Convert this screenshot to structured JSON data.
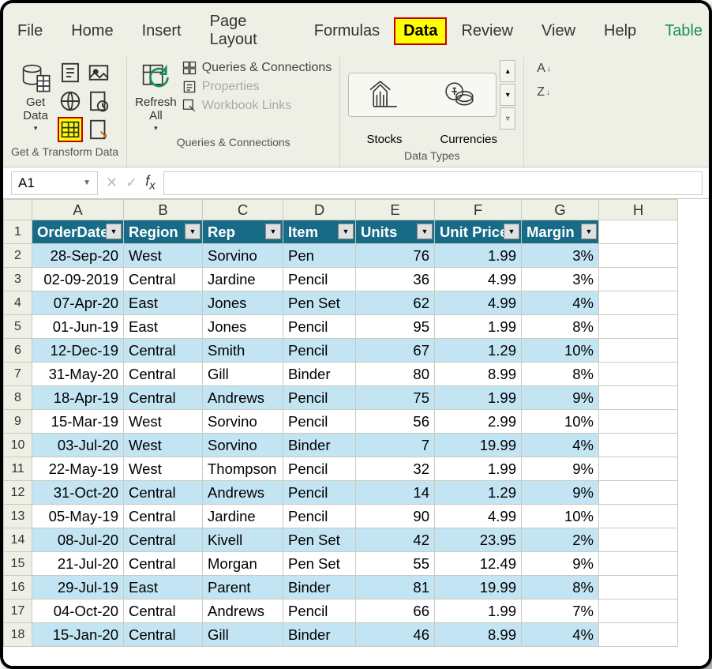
{
  "menu": {
    "items": [
      "File",
      "Home",
      "Insert",
      "Page Layout",
      "Formulas",
      "Data",
      "Review",
      "View",
      "Help",
      "Table"
    ],
    "active": "Data"
  },
  "ribbon": {
    "get_label": "Get\nData",
    "refresh_label": "Refresh\nAll",
    "queries": "Queries & Connections",
    "properties": "Properties",
    "workbook": "Workbook Links",
    "stocks": "Stocks",
    "currencies": "Currencies",
    "group1": "Get & Transform Data",
    "group2": "Queries & Connections",
    "group3": "Data Types"
  },
  "namebox": "A1",
  "formula": "",
  "columns": [
    "A",
    "B",
    "C",
    "D",
    "E",
    "F",
    "G",
    "H"
  ],
  "col_widths": [
    "colA",
    "colB",
    "colC",
    "colD",
    "colE",
    "colF",
    "colG",
    "colH"
  ],
  "headers": [
    "OrderDate",
    "Region",
    "Rep",
    "Item",
    "Units",
    "Unit Price",
    "Margin"
  ],
  "rows": [
    {
      "n": 2,
      "d": [
        "28-Sep-20",
        "West",
        "Sorvino",
        "Pen",
        "76",
        "1.99",
        "3%"
      ]
    },
    {
      "n": 3,
      "d": [
        "02-09-2019",
        "Central",
        "Jardine",
        "Pencil",
        "36",
        "4.99",
        "3%"
      ]
    },
    {
      "n": 4,
      "d": [
        "07-Apr-20",
        "East",
        "Jones",
        "Pen Set",
        "62",
        "4.99",
        "4%"
      ]
    },
    {
      "n": 5,
      "d": [
        "01-Jun-19",
        "East",
        "Jones",
        "Pencil",
        "95",
        "1.99",
        "8%"
      ]
    },
    {
      "n": 6,
      "d": [
        "12-Dec-19",
        "Central",
        "Smith",
        "Pencil",
        "67",
        "1.29",
        "10%"
      ]
    },
    {
      "n": 7,
      "d": [
        "31-May-20",
        "Central",
        "Gill",
        "Binder",
        "80",
        "8.99",
        "8%"
      ]
    },
    {
      "n": 8,
      "d": [
        "18-Apr-19",
        "Central",
        "Andrews",
        "Pencil",
        "75",
        "1.99",
        "9%"
      ]
    },
    {
      "n": 9,
      "d": [
        "15-Mar-19",
        "West",
        "Sorvino",
        "Pencil",
        "56",
        "2.99",
        "10%"
      ]
    },
    {
      "n": 10,
      "d": [
        "03-Jul-20",
        "West",
        "Sorvino",
        "Binder",
        "7",
        "19.99",
        "4%"
      ]
    },
    {
      "n": 11,
      "d": [
        "22-May-19",
        "West",
        "Thompson",
        "Pencil",
        "32",
        "1.99",
        "9%"
      ]
    },
    {
      "n": 12,
      "d": [
        "31-Oct-20",
        "Central",
        "Andrews",
        "Pencil",
        "14",
        "1.29",
        "9%"
      ]
    },
    {
      "n": 13,
      "d": [
        "05-May-19",
        "Central",
        "Jardine",
        "Pencil",
        "90",
        "4.99",
        "10%"
      ]
    },
    {
      "n": 14,
      "d": [
        "08-Jul-20",
        "Central",
        "Kivell",
        "Pen Set",
        "42",
        "23.95",
        "2%"
      ]
    },
    {
      "n": 15,
      "d": [
        "21-Jul-20",
        "Central",
        "Morgan",
        "Pen Set",
        "55",
        "12.49",
        "9%"
      ]
    },
    {
      "n": 16,
      "d": [
        "29-Jul-19",
        "East",
        "Parent",
        "Binder",
        "81",
        "19.99",
        "8%"
      ]
    },
    {
      "n": 17,
      "d": [
        "04-Oct-20",
        "Central",
        "Andrews",
        "Pencil",
        "66",
        "1.99",
        "7%"
      ]
    },
    {
      "n": 18,
      "d": [
        "15-Jan-20",
        "Central",
        "Gill",
        "Binder",
        "46",
        "8.99",
        "4%"
      ]
    }
  ],
  "numeric_cols": [
    4,
    5,
    6
  ],
  "right_align_col0": true
}
